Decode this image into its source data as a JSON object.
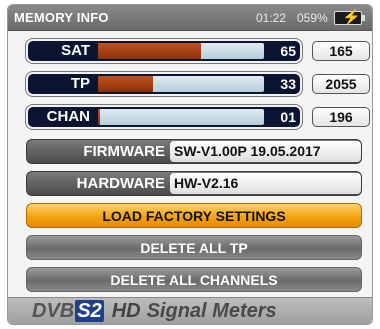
{
  "header": {
    "title": "MEMORY INFO",
    "time": "01:22",
    "battery_percent": "059%",
    "battery_icon": "battery-charging-icon"
  },
  "memory": [
    {
      "label": "SAT",
      "value": "65",
      "count": "165",
      "fill_fraction": 0.62
    },
    {
      "label": "TP",
      "value": "33",
      "count": "2055",
      "fill_fraction": 0.33
    },
    {
      "label": "CHAN",
      "value": "01",
      "count": "196",
      "fill_fraction": 0.01
    }
  ],
  "info": [
    {
      "label": "FIRMWARE",
      "value": "SW-V1.00P 19.05.2017"
    },
    {
      "label": "HARDWARE",
      "value": "HW-V2.16"
    }
  ],
  "actions": [
    {
      "label": "LOAD FACTORY SETTINGS",
      "selected": true
    },
    {
      "label": "DELETE ALL TP",
      "selected": false
    },
    {
      "label": "DELETE ALL CHANNELS",
      "selected": false
    }
  ],
  "footer": {
    "dvb": "DVB",
    "s2": "S2",
    "hd": "HD",
    "brand": "Signal Meters"
  },
  "colors": {
    "bar_fill": "#b04a1a",
    "selected_button": "#f3a313",
    "battery_bolt": "#39e639"
  }
}
